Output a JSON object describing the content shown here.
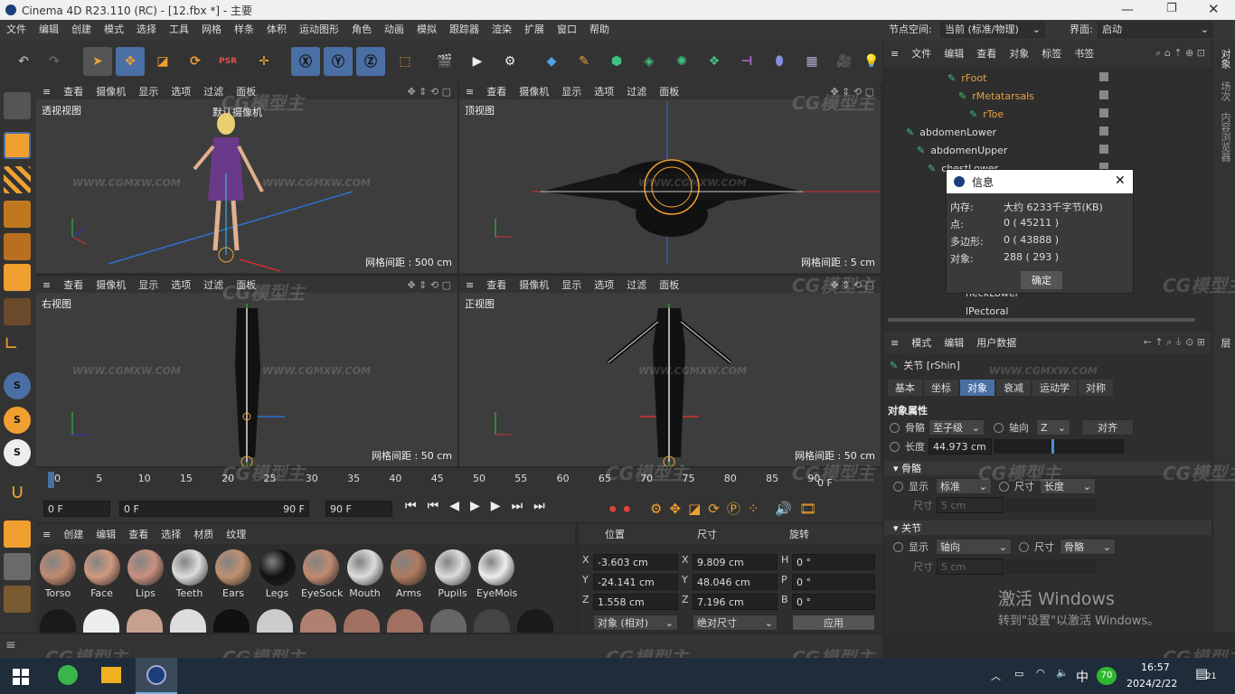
{
  "titlebar": {
    "title": "Cinema 4D R23.110 (RC) - [12.fbx *] - 主要"
  },
  "menubar": {
    "items": [
      "文件",
      "编辑",
      "创建",
      "模式",
      "选择",
      "工具",
      "网格",
      "样条",
      "体积",
      "运动图形",
      "角色",
      "动画",
      "模拟",
      "跟踪器",
      "渲染",
      "扩展",
      "窗口",
      "帮助"
    ],
    "node_space_label": "节点空间:",
    "node_space_value": "当前 (标准/物理)",
    "interface_label": "界面:",
    "interface_value": "启动"
  },
  "viewports": {
    "menu": [
      "查看",
      "摄像机",
      "显示",
      "选项",
      "过滤",
      "面板"
    ],
    "perspective": {
      "name": "透视视图",
      "camera": "默认摄像机",
      "grid": "网格间距 : 500 cm"
    },
    "top": {
      "name": "顶视图",
      "grid": "网格间距 : 5 cm"
    },
    "right": {
      "name": "右视图",
      "grid": "网格间距 : 50 cm"
    },
    "front": {
      "name": "正视图",
      "grid": "网格间距 : 50 cm"
    }
  },
  "timeline": {
    "ticks": [
      "0",
      "5",
      "10",
      "15",
      "20",
      "25",
      "30",
      "35",
      "40",
      "45",
      "50",
      "55",
      "60",
      "65",
      "70",
      "75",
      "80",
      "85",
      "90"
    ],
    "end_frame": "0 F",
    "start_field": "0 F",
    "range_start": "0 F",
    "range_end": "90 F",
    "max_field": "90 F"
  },
  "materials": {
    "menu": [
      "创建",
      "编辑",
      "查看",
      "选择",
      "材质",
      "纹理"
    ],
    "names": [
      "Torso",
      "Face",
      "Lips",
      "Teeth",
      "Ears",
      "Legs",
      "EyeSock",
      "Mouth",
      "Arms",
      "Pupils",
      "EyeMois"
    ]
  },
  "coords": {
    "headers": [
      "位置",
      "尺寸",
      "旋转"
    ],
    "rows": [
      {
        "axis": "X",
        "pos": "-3.603 cm",
        "size_axis": "X",
        "size": "9.809 cm",
        "rot_axis": "H",
        "rot": "0 °"
      },
      {
        "axis": "Y",
        "pos": "-24.141 cm",
        "size_axis": "Y",
        "size": "48.046 cm",
        "rot_axis": "P",
        "rot": "0 °"
      },
      {
        "axis": "Z",
        "pos": "1.558 cm",
        "size_axis": "Z",
        "size": "7.196 cm",
        "rot_axis": "B",
        "rot": "0 °"
      }
    ],
    "mode": "对象 (相对)",
    "size_mode": "绝对尺寸",
    "apply": "应用"
  },
  "objects": {
    "menu": [
      "文件",
      "编辑",
      "查看",
      "对象",
      "标签",
      "书签"
    ],
    "items": [
      {
        "label": "rFoot",
        "indent": 80,
        "color": "#e8a040"
      },
      {
        "label": "rMetatarsals",
        "indent": 92,
        "color": "#e8a040"
      },
      {
        "label": "rToe",
        "indent": 104,
        "color": "#e8a040"
      },
      {
        "label": "abdomenLower",
        "indent": 34,
        "color": "#ddd"
      },
      {
        "label": "abdomenUpper",
        "indent": 46,
        "color": "#ddd"
      },
      {
        "label": "chestLower",
        "indent": 58,
        "color": "#ddd"
      }
    ],
    "partial": [
      "neckLower",
      "lPectoral"
    ]
  },
  "info_dialog": {
    "title": "信息",
    "rows": [
      {
        "k": "内存:",
        "v": "大约 6233千字节(KB)"
      },
      {
        "k": "点:",
        "v": "0 ( 45211 )"
      },
      {
        "k": "多边形:",
        "v": "0 ( 43888 )"
      },
      {
        "k": "对象:",
        "v": "288 ( 293 )"
      }
    ],
    "ok": "确定"
  },
  "attributes": {
    "menu": [
      "模式",
      "编辑",
      "用户数据"
    ],
    "object_title": "关节 [rShin]",
    "tabs": [
      "基本",
      "坐标",
      "对象",
      "衰减",
      "运动学",
      "对称"
    ],
    "section": "对象属性",
    "bone_label": "骨骼",
    "bone_value": "至子级",
    "axis_label": "轴向",
    "axis_value": "Z",
    "align_btn": "对齐",
    "length_label": "长度",
    "length_value": "44.973 cm",
    "bone_group": "骨骼",
    "bone_display_label": "显示",
    "bone_display_value": "标准",
    "bone_size_label": "尺寸",
    "bone_size_value": "长度",
    "bone_size2_label": "尺寸",
    "bone_size2_value": "5 cm",
    "joint_group": "关节",
    "joint_display_label": "显示",
    "joint_display_value": "轴向",
    "joint_size_label": "尺寸",
    "joint_size_value": "骨骼",
    "joint_size2_label": "尺寸",
    "joint_size2_value": "5 cm"
  },
  "side_tabs_right": [
    "对象",
    "场次",
    "内容浏览器",
    "层"
  ],
  "activation": {
    "line1": "激活 Windows",
    "line2": "转到\"设置\"以激活 Windows。"
  },
  "watermark": "CG模型主",
  "watermark_url": "WWW.CGMXW.COM",
  "taskbar": {
    "time": "16:57",
    "date": "2024/2/22",
    "ime": "中",
    "badge": "70",
    "notif": "21"
  }
}
